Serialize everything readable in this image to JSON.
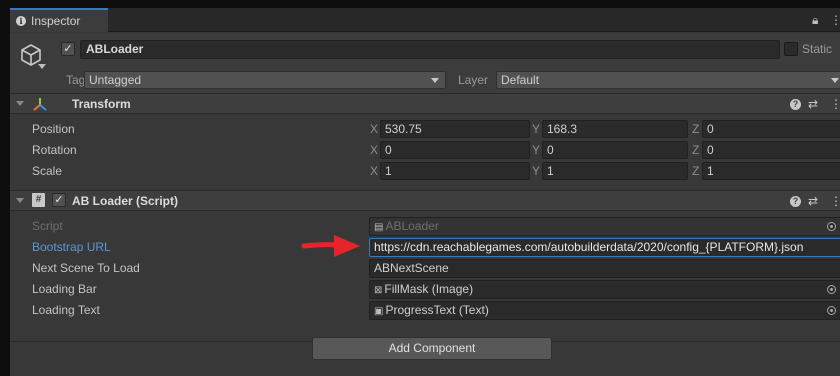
{
  "tab": {
    "icon": "info-icon",
    "label": "Inspector"
  },
  "header": {
    "icon": "cube-icon",
    "active_checked": true,
    "name": "ABLoader",
    "static_label": "Static",
    "tag_label": "Tag",
    "tag_value": "Untagged",
    "layer_label": "Layer",
    "layer_value": "Default"
  },
  "transform": {
    "title": "Transform",
    "rows": [
      {
        "label": "Position",
        "x": "530.75",
        "y": "168.3",
        "z": "0"
      },
      {
        "label": "Rotation",
        "x": "0",
        "y": "0",
        "z": "0"
      },
      {
        "label": "Scale",
        "x": "1",
        "y": "1",
        "z": "1"
      }
    ],
    "axis_labels": {
      "x": "X",
      "y": "Y",
      "z": "Z"
    }
  },
  "script_component": {
    "title": "AB Loader (Script)",
    "enabled": true,
    "fields": [
      {
        "label": "Script",
        "value": "ABLoader",
        "icon": "script-icon"
      },
      {
        "label": "Bootstrap URL",
        "value": "https://cdn.reachablegames.com/autobuilderdata/2020/config_{PLATFORM}.json"
      },
      {
        "label": "Next Scene To Load",
        "value": "ABNextScene"
      },
      {
        "label": "Loading Bar",
        "value": "FillMask (Image)",
        "icon": "image-icon"
      },
      {
        "label": "Loading Text",
        "value": "ProgressText (Text)",
        "icon": "text-icon"
      }
    ]
  },
  "add_component_label": "Add Component",
  "colors": {
    "accent": "#3a79bb",
    "arrow": "#e5252a",
    "panel": "#383838"
  }
}
